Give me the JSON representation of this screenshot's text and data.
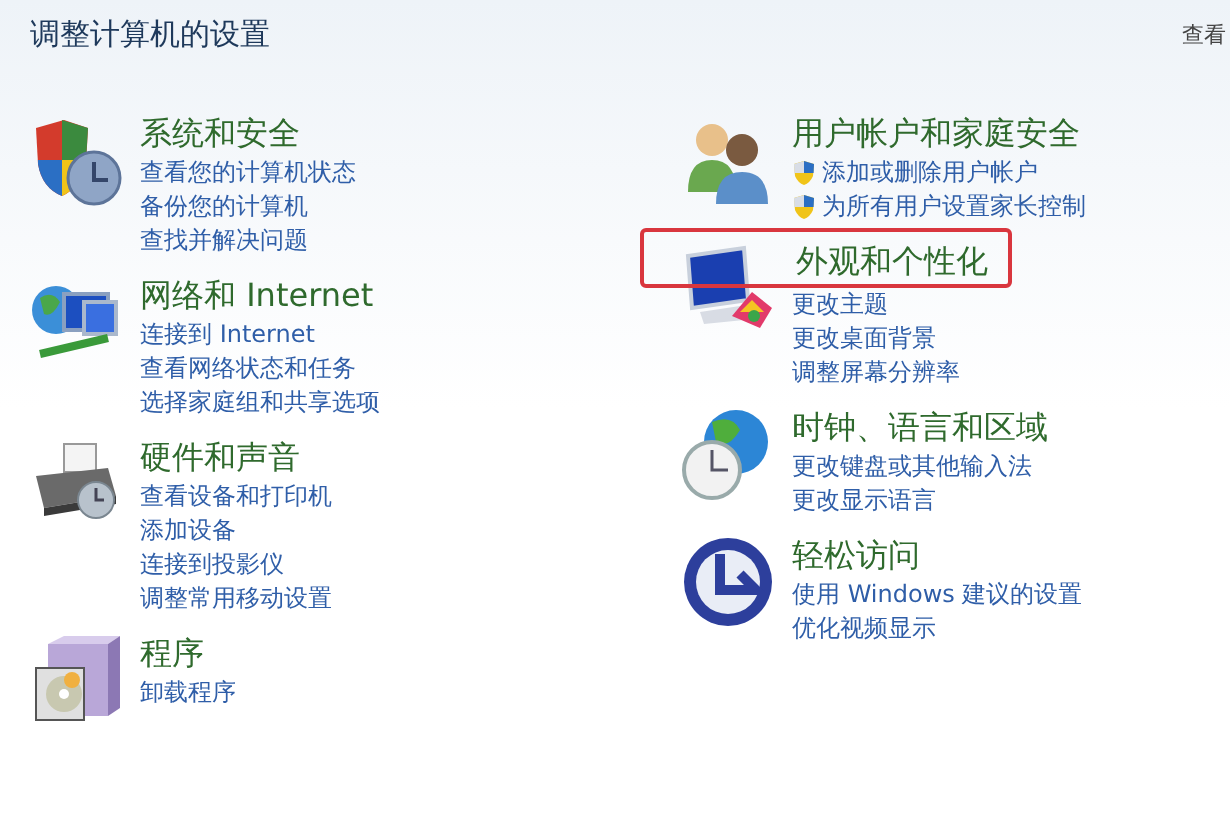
{
  "title": "调整计算机的设置",
  "view_by": "查看",
  "columns": [
    {
      "categories": [
        {
          "kind": "security",
          "title": "系统和安全",
          "highlighted": false,
          "links": [
            {
              "text": "查看您的计算机状态",
              "shield": false
            },
            {
              "text": "备份您的计算机",
              "shield": false
            },
            {
              "text": "查找并解决问题",
              "shield": false
            }
          ]
        },
        {
          "kind": "network",
          "title": "网络和 Internet",
          "highlighted": false,
          "links": [
            {
              "text": "连接到 Internet",
              "shield": false
            },
            {
              "text": "查看网络状态和任务",
              "shield": false
            },
            {
              "text": "选择家庭组和共享选项",
              "shield": false
            }
          ]
        },
        {
          "kind": "hardware",
          "title": "硬件和声音",
          "highlighted": false,
          "links": [
            {
              "text": "查看设备和打印机",
              "shield": false
            },
            {
              "text": "添加设备",
              "shield": false
            },
            {
              "text": "连接到投影仪",
              "shield": false
            },
            {
              "text": "调整常用移动设置",
              "shield": false
            }
          ]
        },
        {
          "kind": "programs",
          "title": "程序",
          "highlighted": false,
          "links": [
            {
              "text": "卸载程序",
              "shield": false
            }
          ]
        }
      ]
    },
    {
      "categories": [
        {
          "kind": "users",
          "title": "用户帐户和家庭安全",
          "highlighted": false,
          "links": [
            {
              "text": "添加或删除用户帐户",
              "shield": true
            },
            {
              "text": "为所有用户设置家长控制",
              "shield": true
            }
          ]
        },
        {
          "kind": "appearance",
          "title": "外观和个性化",
          "highlighted": true,
          "links": [
            {
              "text": "更改主题",
              "shield": false
            },
            {
              "text": "更改桌面背景",
              "shield": false
            },
            {
              "text": "调整屏幕分辨率",
              "shield": false
            }
          ]
        },
        {
          "kind": "clock",
          "title": "时钟、语言和区域",
          "highlighted": false,
          "links": [
            {
              "text": "更改键盘或其他输入法",
              "shield": false
            },
            {
              "text": "更改显示语言",
              "shield": false
            }
          ]
        },
        {
          "kind": "ease",
          "title": "轻松访问",
          "highlighted": false,
          "links": [
            {
              "text": "使用 Windows 建议的设置",
              "shield": false
            },
            {
              "text": "优化视频显示",
              "shield": false
            }
          ]
        }
      ]
    }
  ]
}
